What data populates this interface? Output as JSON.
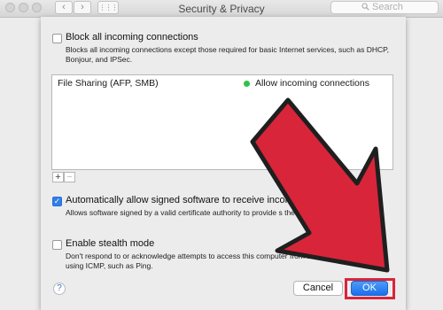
{
  "titlebar": {
    "title": "Security & Privacy",
    "back_glyph": "‹",
    "forward_glyph": "›",
    "grid_glyph": "⋮⋮⋮",
    "search_placeholder": "Search"
  },
  "sheet": {
    "block_all": {
      "label": "Block all incoming connections",
      "description": "Blocks all incoming connections except those required for basic Internet services,  such as DHCP, Bonjour, and IPSec.",
      "checked": false
    },
    "app_list": [
      {
        "name": "File Sharing (AFP, SMB)",
        "status": "Allow incoming connections",
        "status_color": "#2fc14a"
      }
    ],
    "add_glyph": "+",
    "remove_glyph": "−",
    "auto_allow": {
      "label": "Automatically allow signed software to receive incom",
      "description": "Allows software signed by a valid certificate authority to provide s the network.",
      "checked": true
    },
    "stealth": {
      "label": "Enable stealth mode",
      "description": "Don't respond to or acknowledge attempts to access this computer from the ne est applications using ICMP, such as Ping.",
      "checked": false
    },
    "help_glyph": "?",
    "cancel_label": "Cancel",
    "ok_label": "OK"
  },
  "colors": {
    "accent": "#2f7fea",
    "annotation_red": "#d8253a"
  }
}
